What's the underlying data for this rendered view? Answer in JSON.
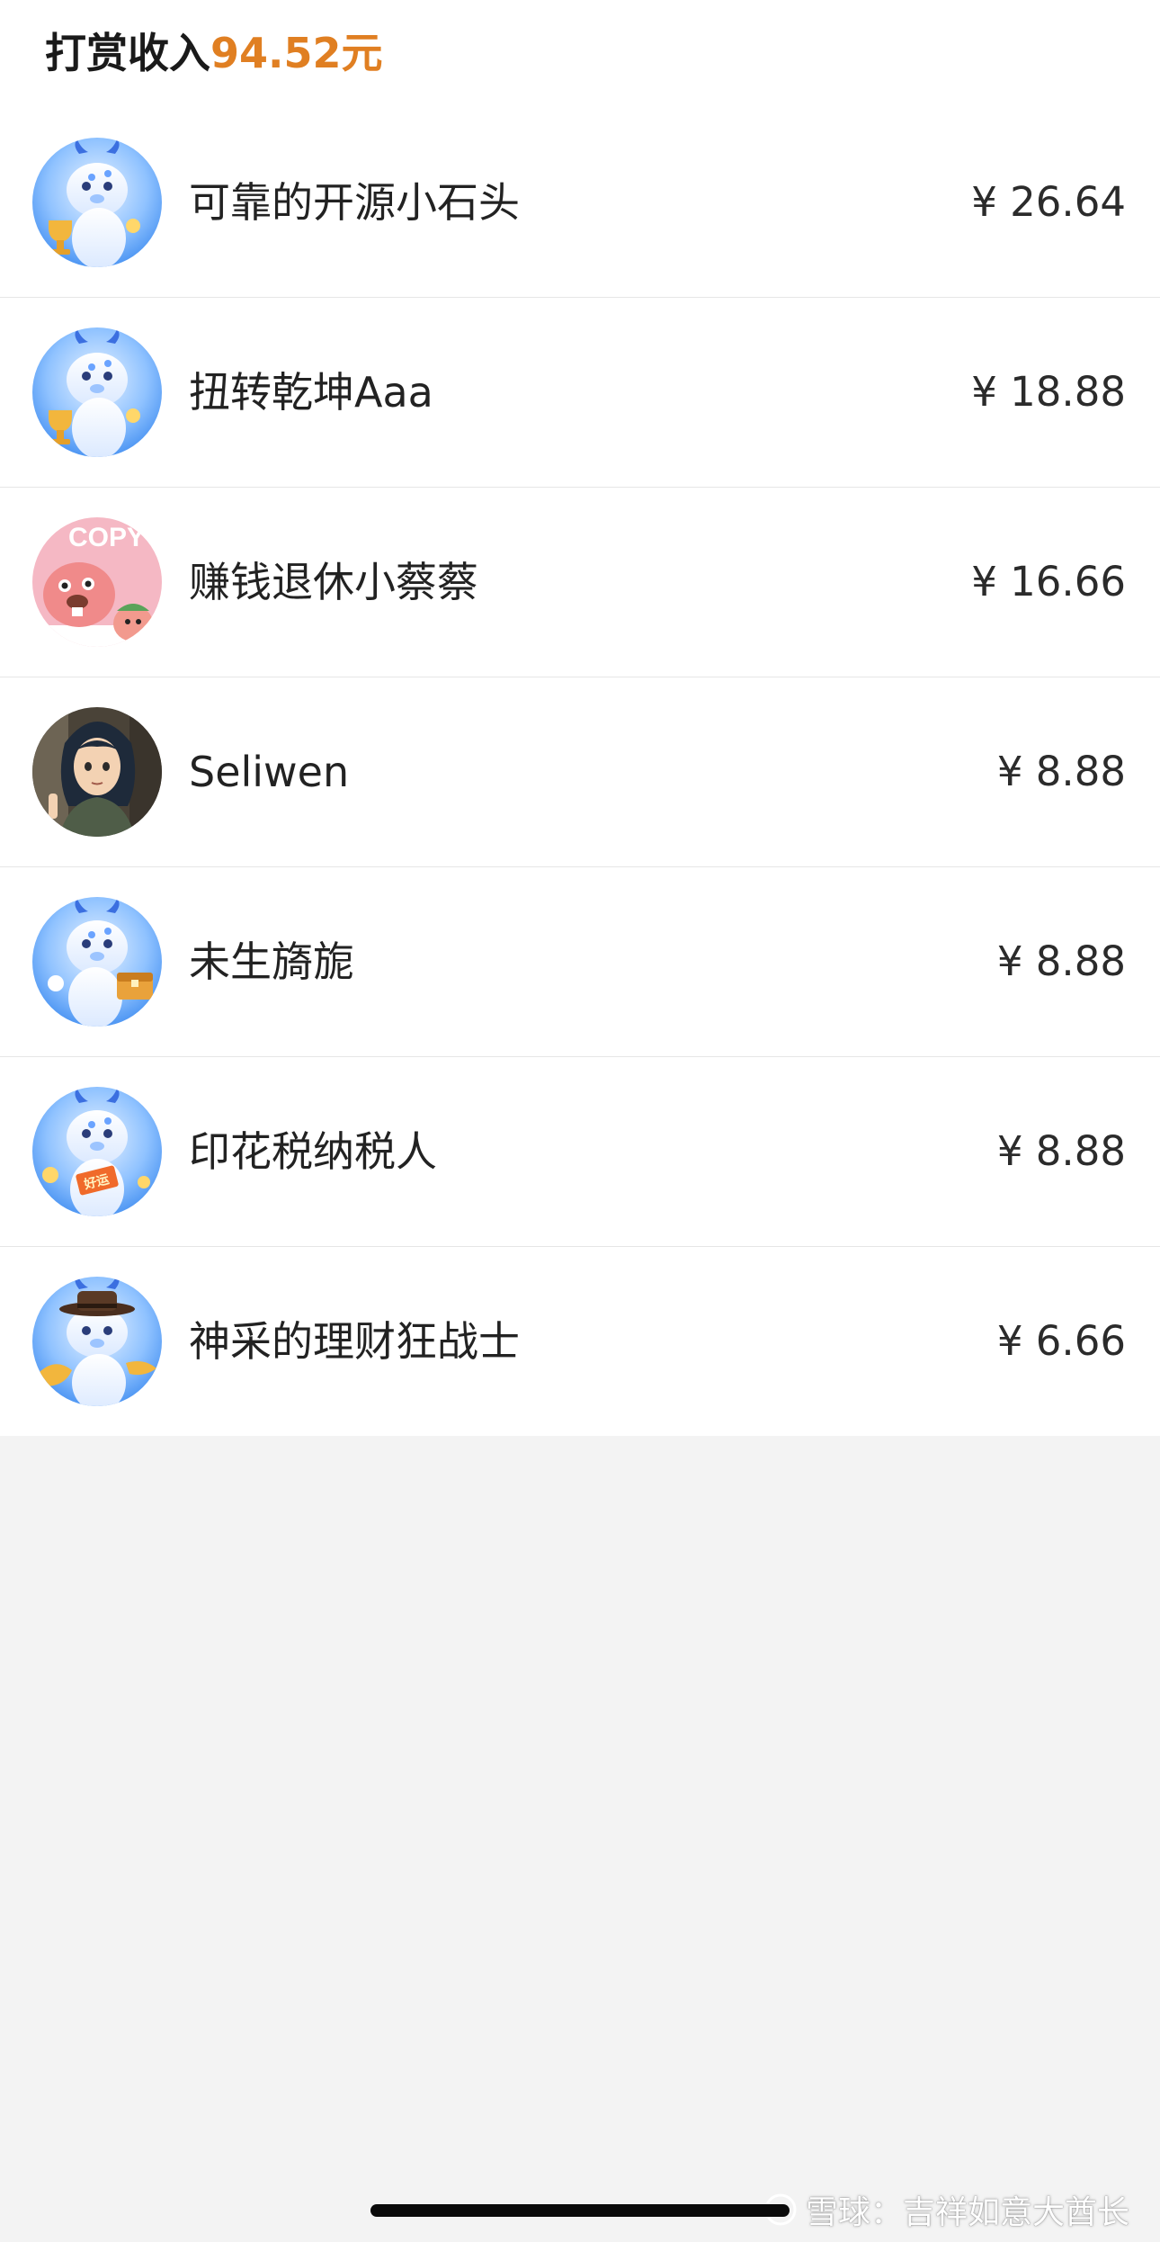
{
  "header": {
    "title_label": "打赏收入",
    "total_amount": "94.52元",
    "accent_color": "#e07f22"
  },
  "tips": [
    {
      "name": "可靠的开源小石头",
      "amount": "¥ 26.64",
      "avatar": "blue-dragon-trophy-avatar"
    },
    {
      "name": "扭转乾坤Aaa",
      "amount": "¥ 18.88",
      "avatar": "blue-dragon-trophy-avatar"
    },
    {
      "name": "赚钱退休小蔡蔡",
      "amount": "¥ 16.66",
      "avatar": "pink-beaver-cartoon-avatar"
    },
    {
      "name": "Seliwen",
      "amount": "¥ 8.88",
      "avatar": "anime-girl-avatar"
    },
    {
      "name": "未生旖旎",
      "amount": "¥ 8.88",
      "avatar": "blue-dragon-treasure-chest-avatar"
    },
    {
      "name": "印花税纳税人",
      "amount": "¥ 8.88",
      "avatar": "blue-dragon-lucky-card-avatar"
    },
    {
      "name": "神采的理财狂战士",
      "amount": "¥ 6.66",
      "avatar": "blue-dragon-cowboy-hat-avatar"
    }
  ],
  "avatar_card_text": "好运",
  "avatar_sticker_text": "COPY",
  "watermark": {
    "text": "雪球：吉祥如意大酋长",
    "icon": "snowball-logo-icon"
  }
}
